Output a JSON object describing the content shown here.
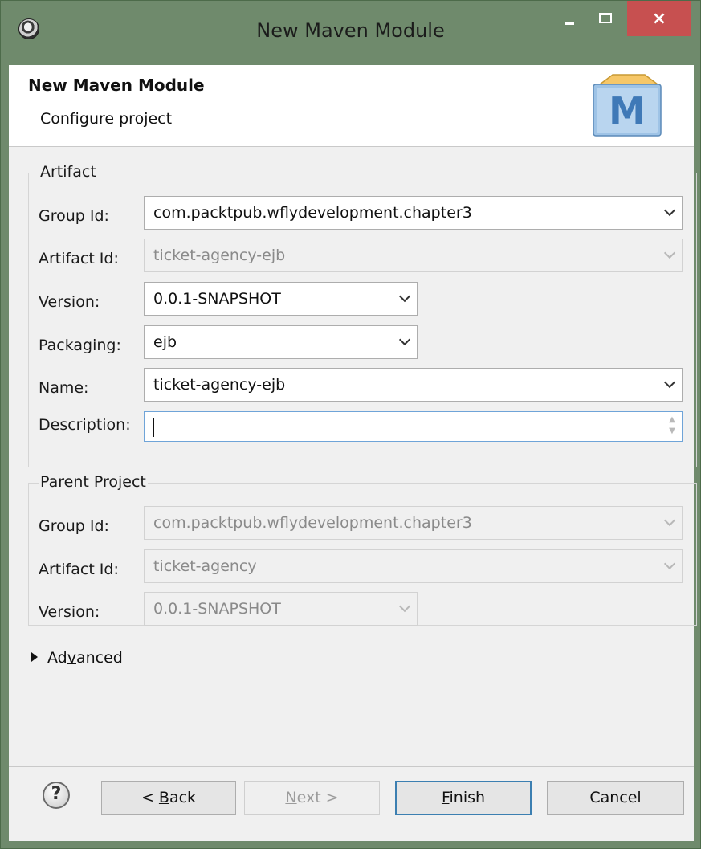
{
  "window": {
    "title": "New Maven Module",
    "close_glyph": "×"
  },
  "banner": {
    "title": "New Maven Module",
    "subtitle": "Configure project",
    "logo_letter": "M"
  },
  "artifact": {
    "legend": "Artifact",
    "group_id": {
      "label": "Group Id:",
      "value": "com.packtpub.wflydevelopment.chapter3"
    },
    "artifact_id": {
      "label": "Artifact Id:",
      "value": "ticket-agency-ejb"
    },
    "version": {
      "label": "Version:",
      "value": "0.0.1-SNAPSHOT"
    },
    "packaging": {
      "label": "Packaging:",
      "value": "ejb"
    },
    "name": {
      "label": "Name:",
      "value": "ticket-agency-ejb"
    },
    "description": {
      "label": "Description:",
      "value": ""
    }
  },
  "parent": {
    "legend": "Parent Project",
    "group_id": {
      "label": "Group Id:",
      "value": "com.packtpub.wflydevelopment.chapter3"
    },
    "artifact_id": {
      "label": "Artifact Id:",
      "value": "ticket-agency"
    },
    "version": {
      "label": "Version:",
      "value": "0.0.1-SNAPSHOT"
    }
  },
  "advanced": {
    "label_pre": "Ad",
    "label_mnemonic": "v",
    "label_post": "anced"
  },
  "buttons": {
    "help": "?",
    "back": {
      "pre": "< ",
      "mnemonic": "B",
      "post": "ack"
    },
    "next": {
      "mnemonic": "N",
      "post": "ext >"
    },
    "finish": {
      "mnemonic": "F",
      "post": "inish"
    },
    "cancel": "Cancel"
  },
  "icons": {
    "app": "eclipse-icon",
    "minimize": "minimize-icon",
    "maximize": "maximize-icon",
    "close": "close-icon",
    "dropdown": "chevron-down-icon",
    "expander": "triangle-right-icon",
    "help": "help-icon"
  },
  "colors": {
    "title_bar": "#6f8a6c",
    "close_button": "#c75050",
    "dialog_bg": "#f0f0f0",
    "focus_border": "#6fa4d8",
    "default_button_border": "#3c7fb1"
  }
}
